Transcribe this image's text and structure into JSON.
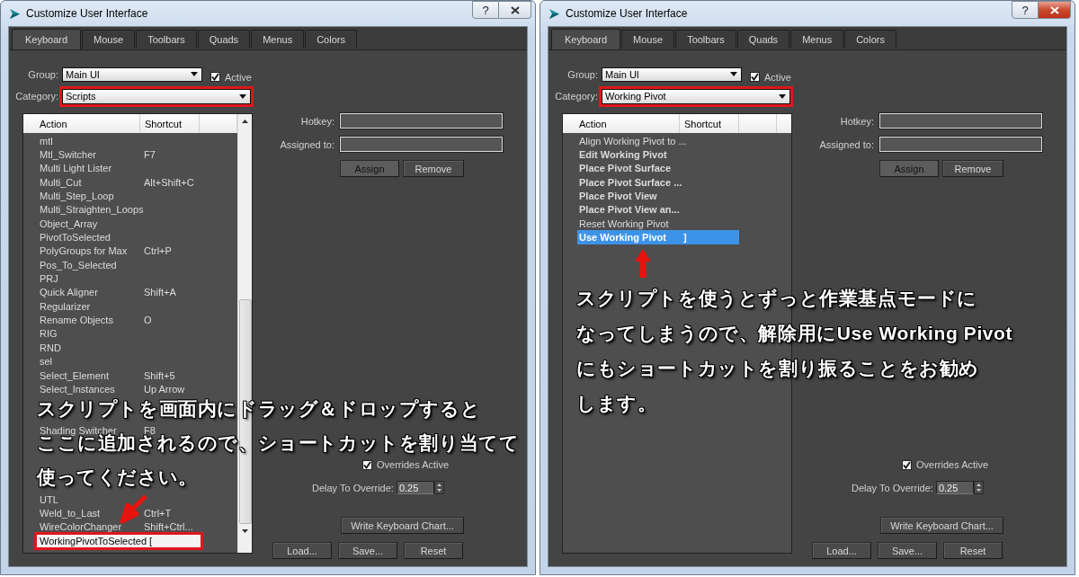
{
  "windows": [
    {
      "title": "Customize User Interface",
      "help_button": "?",
      "active": false,
      "tabs": [
        {
          "label": "Keyboard",
          "selected": true
        },
        {
          "label": "Mouse",
          "selected": false
        },
        {
          "label": "Toolbars",
          "selected": false
        },
        {
          "label": "Quads",
          "selected": false
        },
        {
          "label": "Menus",
          "selected": false
        },
        {
          "label": "Colors",
          "selected": false
        }
      ],
      "group": {
        "label": "Group:",
        "value": "Main UI"
      },
      "active_checkbox": {
        "label": "Active",
        "checked": true
      },
      "category": {
        "label": "Category:",
        "value": "Scripts",
        "outlined": true
      },
      "list": {
        "columns": [
          "Action",
          "Shortcut"
        ],
        "focused": false,
        "scrollable": true,
        "rows": [
          {
            "kind": "item",
            "action": "mtl",
            "selected": false,
            "bold": false,
            "outlined": false
          },
          {
            "kind": "item",
            "action": "Mtl_Switcher",
            "shortcut": "F7",
            "selected": false,
            "bold": false,
            "outlined": false
          },
          {
            "kind": "item",
            "action": "Multi Light Lister",
            "selected": false,
            "bold": false,
            "outlined": false
          },
          {
            "kind": "item",
            "action": "Multi_Cut",
            "shortcut": "Alt+Shift+C",
            "selected": false,
            "bold": false,
            "outlined": false
          },
          {
            "kind": "item",
            "action": "Multi_Step_Loop",
            "selected": false,
            "bold": false,
            "outlined": false
          },
          {
            "kind": "item",
            "action": "Multi_Straighten_Loops",
            "selected": false,
            "bold": false,
            "outlined": false
          },
          {
            "kind": "item",
            "action": "Object_Array",
            "selected": false,
            "bold": false,
            "outlined": false
          },
          {
            "kind": "item",
            "action": "PivotToSelected",
            "selected": false,
            "bold": false,
            "outlined": false
          },
          {
            "kind": "item",
            "action": "PolyGroups for Max",
            "shortcut": "Ctrl+P",
            "selected": false,
            "bold": false,
            "outlined": false
          },
          {
            "kind": "item",
            "action": "Pos_To_Selected",
            "selected": false,
            "bold": false,
            "outlined": false
          },
          {
            "kind": "item",
            "action": "PRJ",
            "selected": false,
            "bold": false,
            "outlined": false
          },
          {
            "kind": "item",
            "action": "Quick Aligner",
            "shortcut": "Shift+A",
            "selected": false,
            "bold": false,
            "outlined": false
          },
          {
            "kind": "item",
            "action": "Regularizer",
            "selected": false,
            "bold": false,
            "outlined": false
          },
          {
            "kind": "item",
            "action": "Rename Objects",
            "shortcut": "O",
            "selected": false,
            "bold": false,
            "outlined": false
          },
          {
            "kind": "item",
            "action": "RIG",
            "selected": false,
            "bold": false,
            "outlined": false
          },
          {
            "kind": "item",
            "action": "RND",
            "selected": false,
            "bold": false,
            "outlined": false
          },
          {
            "kind": "item",
            "action": "sel",
            "selected": false,
            "bold": false,
            "outlined": false
          },
          {
            "kind": "item",
            "action": "Select_Element",
            "shortcut": "Shift+5",
            "selected": false,
            "bold": false,
            "outlined": false
          },
          {
            "kind": "item",
            "action": "Select_Instances",
            "shortcut": "Up Arrow",
            "selected": false,
            "bold": false,
            "outlined": false
          },
          {
            "kind": "hidden"
          },
          {
            "kind": "hidden"
          },
          {
            "kind": "item",
            "action": "Shading Switcher",
            "shortcut": "F8",
            "selected": false,
            "bold": false,
            "outlined": false
          },
          {
            "kind": "hidden"
          },
          {
            "kind": "hidden"
          },
          {
            "kind": "hidden"
          },
          {
            "kind": "hidden"
          },
          {
            "kind": "item",
            "action": "UTL",
            "selected": false,
            "bold": false,
            "outlined": false
          },
          {
            "kind": "item",
            "action": "Weld_to_Last",
            "shortcut": "Ctrl+T",
            "selected": false,
            "bold": false,
            "outlined": false
          },
          {
            "kind": "item",
            "action": "WireColorChanger",
            "shortcut": "Shift+Ctrl...",
            "selected": false,
            "bold": false,
            "outlined": false
          },
          {
            "kind": "item",
            "action": "WorkingPivotToSelected",
            "shortcut": "[",
            "selected": true,
            "bold": false,
            "outlined": true
          }
        ]
      },
      "hotkey": {
        "label": "Hotkey:"
      },
      "assigned_to": {
        "label": "Assigned to:"
      },
      "buttons": [
        "Assign",
        "Remove"
      ],
      "overrides": {
        "label": "Overrides Active",
        "checked": true
      },
      "delay": {
        "label": "Delay To Override:",
        "value": "0.25"
      },
      "chart_button": "Write Keyboard Chart...",
      "file_buttons": [
        "Load...",
        "Save...",
        "Reset"
      ],
      "annotation": {
        "lines": [
          "スクリプトを画面内にドラッグ＆ドロップすると",
          "ここに追加されるので、ショートカットを割り当てて",
          "使ってください。"
        ]
      }
    },
    {
      "title": "Customize User Interface",
      "help_button": "?",
      "active": true,
      "tabs": [
        {
          "label": "Keyboard",
          "selected": true
        },
        {
          "label": "Mouse",
          "selected": false
        },
        {
          "label": "Toolbars",
          "selected": false
        },
        {
          "label": "Quads",
          "selected": false
        },
        {
          "label": "Menus",
          "selected": false
        },
        {
          "label": "Colors",
          "selected": false
        }
      ],
      "group": {
        "label": "Group:",
        "value": "Main UI"
      },
      "active_checkbox": {
        "label": "Active",
        "checked": true
      },
      "category": {
        "label": "Category:",
        "value": "Working Pivot",
        "outlined": true
      },
      "list": {
        "columns": [
          "Action",
          "Shortcut"
        ],
        "focused": true,
        "scrollable": false,
        "rows": [
          {
            "kind": "item",
            "action": "Align Working Pivot to ...",
            "selected": false,
            "bold": false,
            "outlined": false
          },
          {
            "kind": "item",
            "action": "Edit Working Pivot",
            "selected": false,
            "bold": true,
            "outlined": false
          },
          {
            "kind": "item",
            "action": "Place Pivot Surface",
            "selected": false,
            "bold": true,
            "outlined": false
          },
          {
            "kind": "item",
            "action": "Place Pivot Surface ...",
            "selected": false,
            "bold": true,
            "outlined": false
          },
          {
            "kind": "item",
            "action": "Place Pivot View",
            "selected": false,
            "bold": true,
            "outlined": false
          },
          {
            "kind": "item",
            "action": "Place Pivot View an...",
            "selected": false,
            "bold": true,
            "outlined": false
          },
          {
            "kind": "item",
            "action": "Reset Working Pivot",
            "selected": false,
            "bold": false,
            "outlined": false
          },
          {
            "kind": "item",
            "action": "Use Working Pivot",
            "shortcut": "]",
            "selected": true,
            "bold": true,
            "outlined": false
          }
        ]
      },
      "hotkey": {
        "label": "Hotkey:"
      },
      "assigned_to": {
        "label": "Assigned to:"
      },
      "buttons": [
        "Assign",
        "Remove"
      ],
      "overrides": {
        "label": "Overrides Active",
        "checked": true
      },
      "delay": {
        "label": "Delay To Override:",
        "value": "0.25"
      },
      "chart_button": "Write Keyboard Chart...",
      "file_buttons": [
        "Load...",
        "Save...",
        "Reset"
      ],
      "annotation": {
        "lines": [
          "スクリプトを使うとずっと作業基点モードに",
          "なってしまうので、解除用にUse Working Pivot",
          "にもショートカットを割り振ることをお勧め",
          "します。"
        ]
      }
    }
  ]
}
